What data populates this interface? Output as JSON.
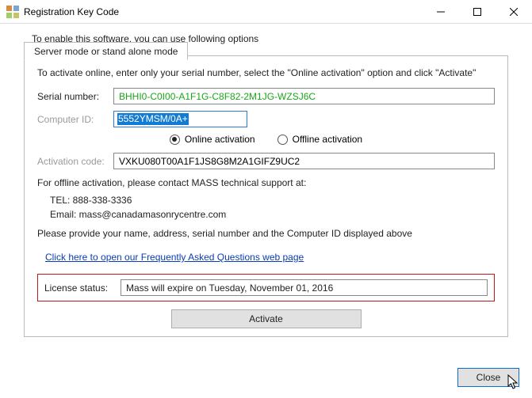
{
  "window_title": "Registration Key Code",
  "intro": "To enable this software, you can use following options",
  "tab_label": "Server mode or stand alone mode",
  "instructions": "To activate online, enter only your serial number, select the \"Online activation\" option and click \"Activate\"",
  "fields": {
    "serial_label": "Serial number:",
    "serial_value": "BHHI0-C0I00-A1F1G-C8F82-2M1JG-WZSJ6C",
    "computer_id_label": "Computer ID:",
    "computer_id_value": "5552YMSM/0A+",
    "activation_code_label": "Activation code:",
    "activation_code_value": "VXKU080T00A1F1JS8G8M2A1GIFZ9UC2"
  },
  "radio": {
    "online": "Online activation",
    "offline": "Offline activation",
    "selected": "online"
  },
  "support": {
    "header": "For offline activation, please contact MASS technical support at:",
    "tel": "TEL:   888-338-3336",
    "email": "Email: mass@canadamasonrycentre.com",
    "footer": "Please provide your name, address, serial number and the Computer ID displayed above"
  },
  "faq_link": "Click here to open our Frequently Asked Questions web page",
  "license": {
    "label": "License status:",
    "value": "Mass will expire on Tuesday, November 01, 2016"
  },
  "buttons": {
    "activate": "Activate",
    "close": "Close"
  }
}
